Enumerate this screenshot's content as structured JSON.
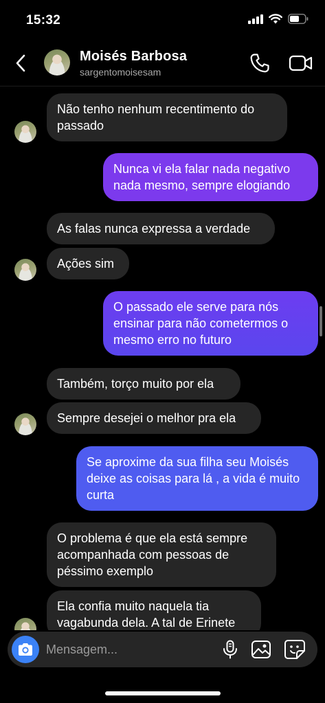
{
  "status_bar": {
    "time": "15:32"
  },
  "header": {
    "name": "Moisés  Barbosa",
    "username": "sargentomoisesam"
  },
  "messages": [
    {
      "dir": "in",
      "text": "Não tenho nenhum recentimento do passado"
    },
    {
      "dir": "out",
      "text": "Nunca vi ela falar nada negativo nada mesmo, sempre elogiando"
    },
    {
      "dir": "in",
      "text": "As falas nunca expressa a verdade"
    },
    {
      "dir": "in",
      "text": "Ações sim"
    },
    {
      "dir": "out",
      "text": "O passado ele serve para nós ensinar para não cometermos o mesmo erro no futuro"
    },
    {
      "dir": "in",
      "text": "Também, torço muito por ela"
    },
    {
      "dir": "in",
      "text": "Sempre desejei o melhor pra ela"
    },
    {
      "dir": "out",
      "text": "Se aproxime da sua filha seu Moisés deixe as coisas para lá , a vida é muito curta"
    },
    {
      "dir": "in",
      "text": "O problema é que ela está sempre acompanhada com pessoas de péssimo exemplo"
    },
    {
      "dir": "in",
      "text": "Ela confia muito naquela tia vagabunda dela. A tal de Erinete"
    }
  ],
  "composer": {
    "placeholder": "Mensagem..."
  },
  "colors": {
    "incoming_bubble": "#262626",
    "outgoing_purple": "#7c3aed",
    "outgoing_blue": "#4f5cf0",
    "camera_button": "#3b82f6"
  }
}
